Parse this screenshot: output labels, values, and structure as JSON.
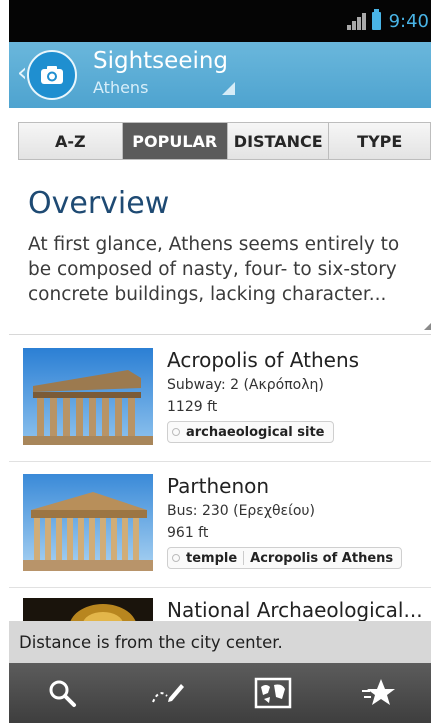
{
  "status_bar": {
    "time": "9:40",
    "signal_icon": "signal-icon",
    "battery_icon": "battery-icon"
  },
  "action_bar": {
    "title": "Sightseeing",
    "subtitle": "Athens",
    "app_icon": "camera-icon",
    "accent": "#4ea3cf"
  },
  "tabs": [
    {
      "label": "A-Z",
      "active": false
    },
    {
      "label": "POPULAR",
      "active": true
    },
    {
      "label": "DISTANCE",
      "active": false
    },
    {
      "label": "TYPE",
      "active": false
    }
  ],
  "overview": {
    "title": "Overview",
    "text": "At first glance, Athens seems entirely to be composed of nasty, four- to six-story concrete buildings, lacking character..."
  },
  "places": [
    {
      "name": "Acropolis of Athens",
      "transit": "Subway: 2 (Ακρόπολη)",
      "distance": "1129 ft",
      "tags": [
        "archaeological site"
      ]
    },
    {
      "name": "Parthenon",
      "transit": "Bus: 230 (Ερεχθείου)",
      "distance": "961 ft",
      "tags": [
        "temple",
        "Acropolis of Athens"
      ]
    },
    {
      "name": "National Archaeological...",
      "transit": "",
      "distance": "",
      "tags": []
    }
  ],
  "footer_note": "Distance is from the city center.",
  "bottom_bar": {
    "icons": [
      "search-icon",
      "route-icon",
      "map-icon",
      "favorites-icon"
    ]
  }
}
